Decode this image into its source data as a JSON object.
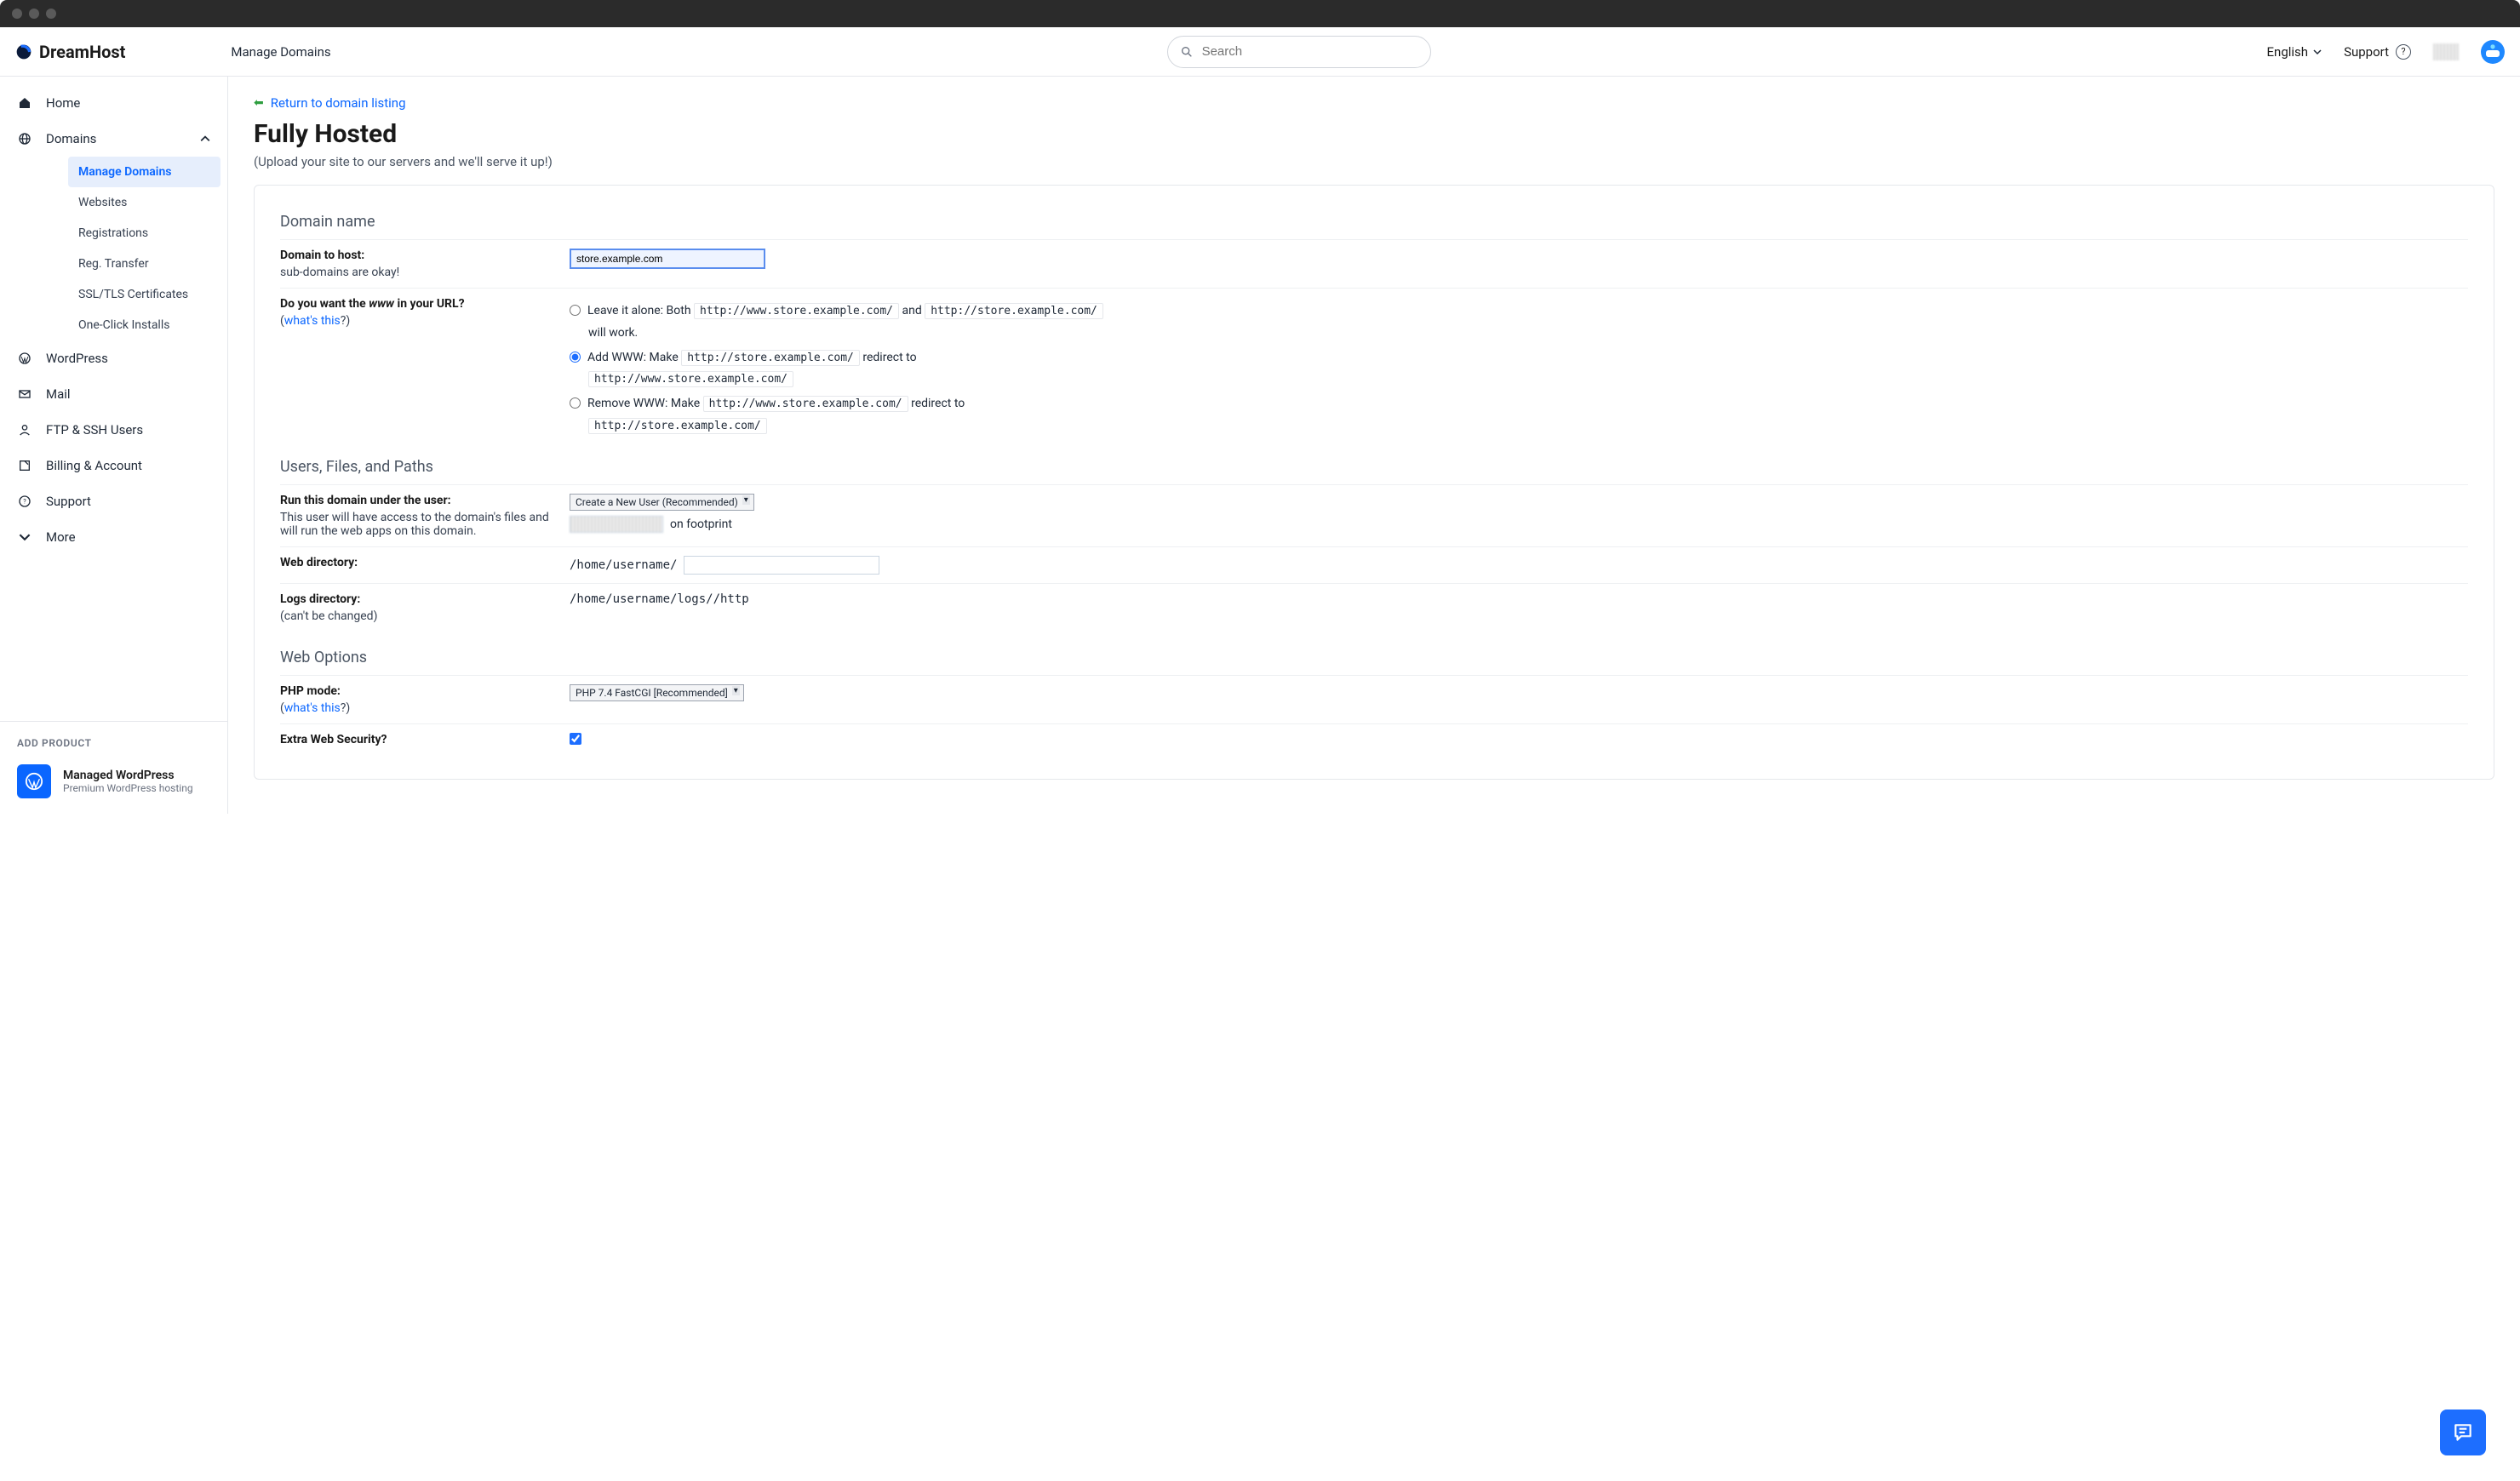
{
  "topbar": {
    "brand": "DreamHost",
    "title": "Manage Domains",
    "search_placeholder": "Search",
    "language": "English",
    "support": "Support"
  },
  "sidebar": {
    "home": "Home",
    "domains": "Domains",
    "domains_sub": {
      "manage": "Manage Domains",
      "websites": "Websites",
      "registrations": "Registrations",
      "reg_transfer": "Reg. Transfer",
      "ssl": "SSL/TLS Certificates",
      "oneclick": "One-Click Installs"
    },
    "wordpress": "WordPress",
    "mail": "Mail",
    "ftp": "FTP & SSH Users",
    "billing": "Billing & Account",
    "support": "Support",
    "more": "More",
    "add_product": "ADD PRODUCT",
    "wp_promo_title": "Managed WordPress",
    "wp_promo_sub": "Premium WordPress hosting"
  },
  "main": {
    "back": "Return to domain listing",
    "title": "Fully Hosted",
    "subtitle": "(Upload your site to our servers and we'll serve it up!)",
    "section_domain": "Domain name",
    "domain_to_host_label": "Domain to host:",
    "domain_to_host_value": "store.example.com",
    "domain_hint": "sub-domains are okay!",
    "www_label_pre": "Do you want the ",
    "www_label_em": "www",
    "www_label_post": " in your URL?",
    "whats_this": "what's this",
    "www_leave_pre": "Leave it alone: Both ",
    "url_www": "http://www.store.example.com/",
    "and_word": " and ",
    "url_plain": "http://store.example.com/",
    "will_work": "will work.",
    "add_www_pre": "Add WWW: Make ",
    "redirect_to": " redirect to",
    "remove_www_pre": "Remove WWW: Make ",
    "section_users": "Users, Files, and Paths",
    "run_user_label": "Run this domain under the user:",
    "run_user_hint": "This user will have access to the domain's files and will run the web apps on this domain.",
    "run_user_select": "Create a New User (Recommended)",
    "on_footprint": "on footprint",
    "web_dir_label": "Web directory:",
    "web_dir_value": "/home/username/",
    "logs_dir_label": "Logs directory:",
    "logs_dir_value": "/home/username/logs//http",
    "logs_hint": "(can't be changed)",
    "section_weboptions": "Web Options",
    "php_label": "PHP mode:",
    "php_value": "PHP 7.4 FastCGI [Recommended]",
    "extra_sec_label": "Extra Web Security?"
  }
}
